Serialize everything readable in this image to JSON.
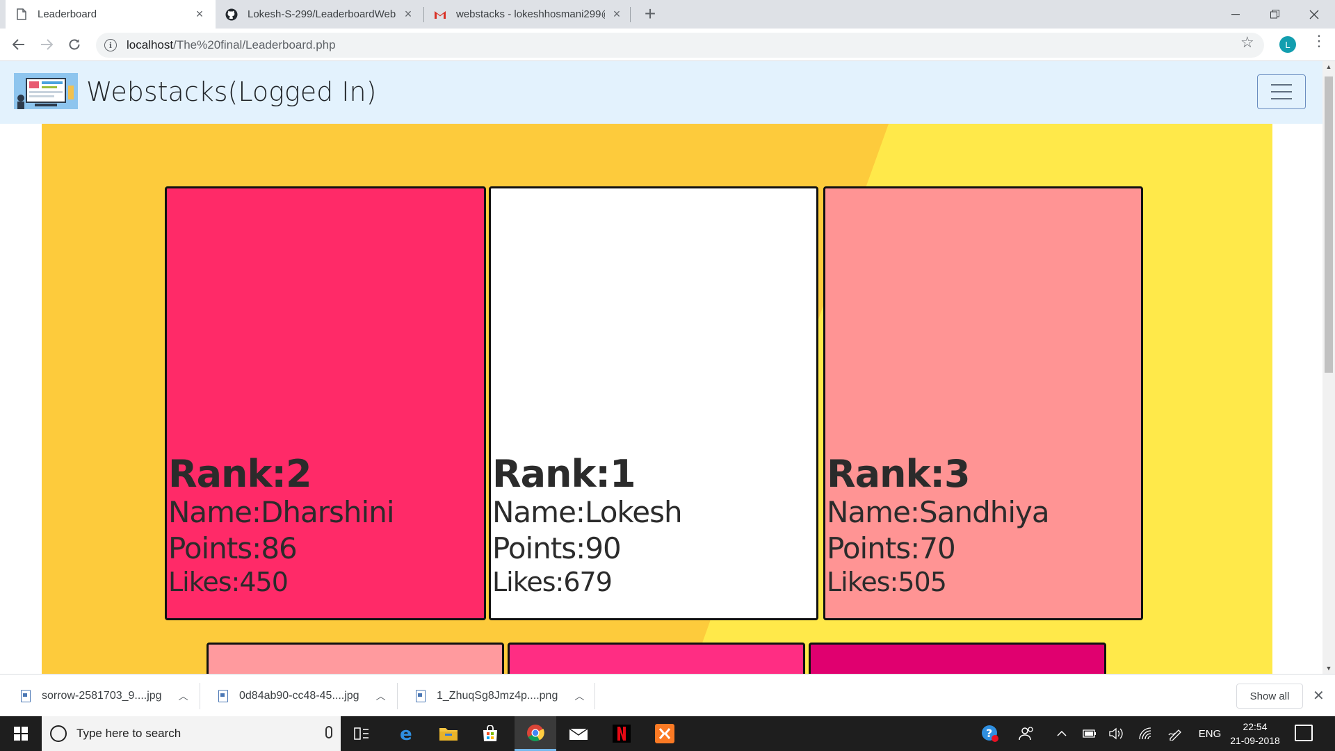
{
  "browser": {
    "tabs": [
      {
        "title": "Leaderboard",
        "active": true,
        "icon": "page-icon"
      },
      {
        "title": "Lokesh-S-299/LeaderboardWebs",
        "active": false,
        "icon": "github-icon"
      },
      {
        "title": "webstacks - lokeshhosmani299@",
        "active": false,
        "icon": "gmail-icon"
      }
    ],
    "url_host": "localhost",
    "url_path": "/The%20final/Leaderboard.php",
    "profile_initial": "L"
  },
  "site": {
    "brand": "Webstacks(Logged In)"
  },
  "leaderboard": {
    "top_cards": [
      {
        "rank_label": "Rank:2",
        "name_label": "Name:Dharshini",
        "points_label": "Points:86",
        "likes_label": "Likes:450",
        "color": "#ff2a68"
      },
      {
        "rank_label": "Rank:1",
        "name_label": "Name:Lokesh",
        "points_label": "Points:90",
        "likes_label": "Likes:679",
        "color": "#ffffff"
      },
      {
        "rank_label": "Rank:3",
        "name_label": "Name:Sandhiya",
        "points_label": "Points:70",
        "likes_label": "Likes:505",
        "color": "#ff9494"
      }
    ],
    "next_row_colors": [
      "#ff9a9e",
      "#ff2d83",
      "#e0006f"
    ]
  },
  "downloads": {
    "items": [
      {
        "name": "sorrow-2581703_9....jpg"
      },
      {
        "name": "0d84ab90-cc48-45....jpg"
      },
      {
        "name": "1_ZhuqSg8Jmz4p....png"
      }
    ],
    "show_all": "Show all"
  },
  "taskbar": {
    "search_placeholder": "Type here to search",
    "language": "ENG",
    "time": "22:54",
    "date": "21-09-2018"
  },
  "colors": {
    "hero_orange": "#fdcb3c",
    "hero_yellow": "#ffe94a",
    "nav_bg": "#e3f2fd"
  }
}
